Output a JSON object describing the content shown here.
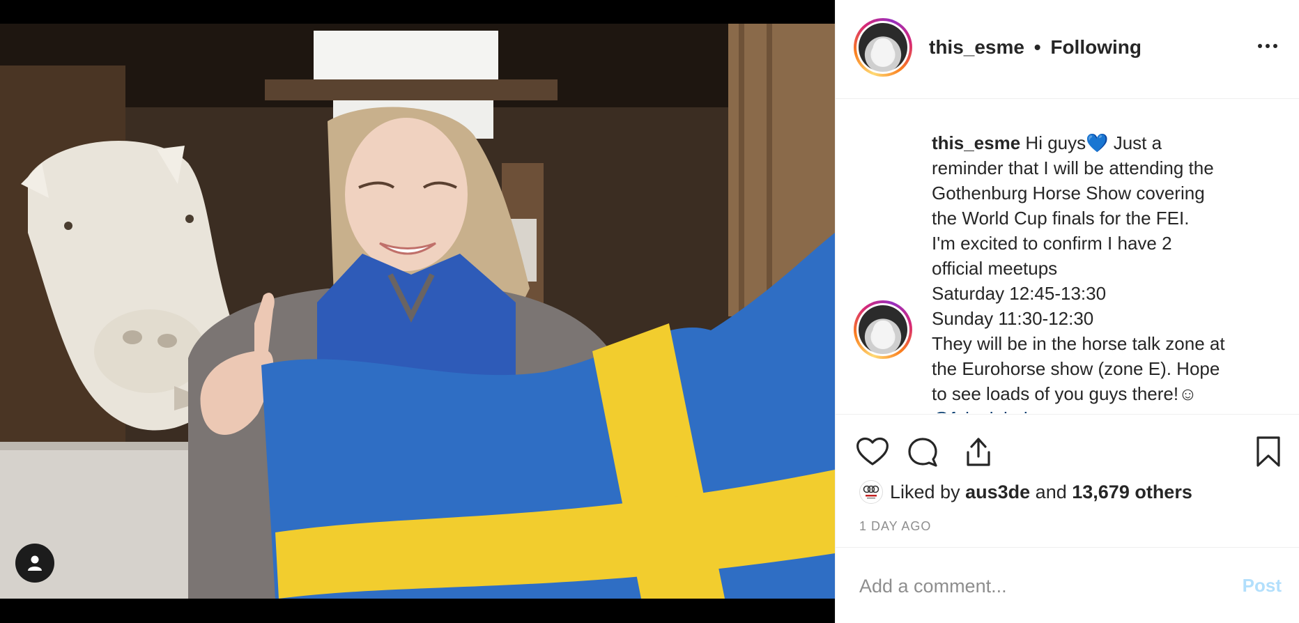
{
  "post": {
    "username": "this_esme",
    "separator": "•",
    "follow_status": "Following",
    "more_icon": "more-horizontal-icon"
  },
  "caption": {
    "username": "this_esme",
    "lines": [
      "Hi guys💙  Just a",
      "reminder that I will be attending the",
      "Gothenburg Horse Show covering",
      "the World Cup finals for the FEI.",
      "I'm excited to confirm I have 2",
      "official meetups",
      "Saturday 12:45-13:30",
      "Sunday 11:30-12:30",
      "They will be in the horse talk zone at",
      "the Eurohorse show (zone E). Hope",
      "to see loads of you guys there!☺"
    ],
    "partial_line": "@fei_global"
  },
  "actions": {
    "like_icon": "heart-icon",
    "comment_icon": "comment-icon",
    "share_icon": "share-icon",
    "save_icon": "bookmark-icon"
  },
  "likes": {
    "prefix": "Liked by",
    "first_user": "aus3de",
    "connector": "and",
    "others": "13,679 others"
  },
  "timestamp": "1 DAY AGO",
  "comment": {
    "placeholder": "Add a comment...",
    "post_label": "Post"
  },
  "colors": {
    "link": "#00376b",
    "post_disabled": "#b2dffc",
    "muted": "#8e8e8e",
    "text": "#262626"
  }
}
